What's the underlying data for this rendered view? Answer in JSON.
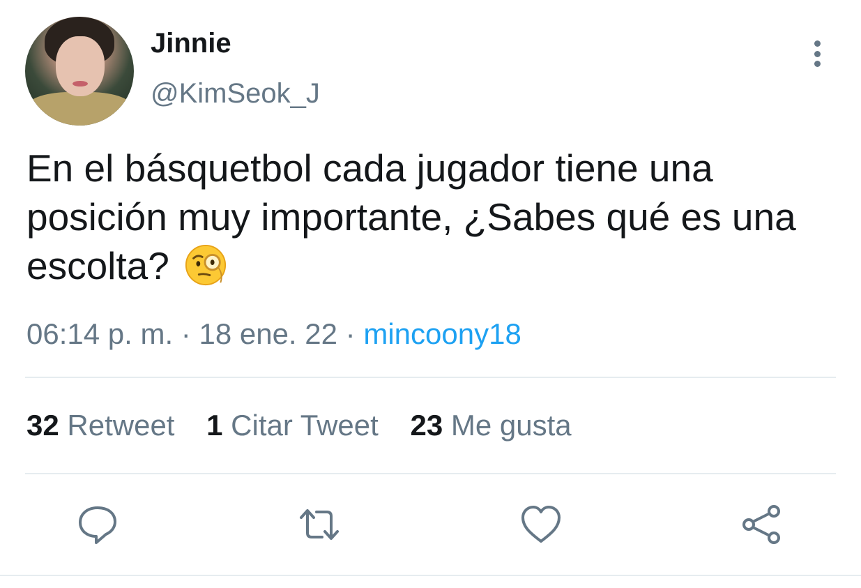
{
  "author": {
    "name": "Jinnie",
    "handle": "@KimSeok_J"
  },
  "tweet": {
    "text": "En el básquetbol cada jugador tiene una posición muy importante, ¿Sabes qué es una escolta?",
    "emoji": "face-with-monocle-icon"
  },
  "meta": {
    "time": "06:14 p. m.",
    "separator": "·",
    "date": "18 ene. 22",
    "source": "mincoony18"
  },
  "stats": {
    "retweets_count": "32",
    "retweets_label": "Retweet",
    "quotes_count": "1",
    "quotes_label": "Citar Tweet",
    "likes_count": "23",
    "likes_label": "Me gusta"
  },
  "actions": [
    "reply-icon",
    "retweet-icon",
    "like-icon",
    "share-icon"
  ],
  "colors": {
    "text": "#14171a",
    "secondary": "#657786",
    "accent": "#1da1f2",
    "divider": "#e6ecf0"
  }
}
